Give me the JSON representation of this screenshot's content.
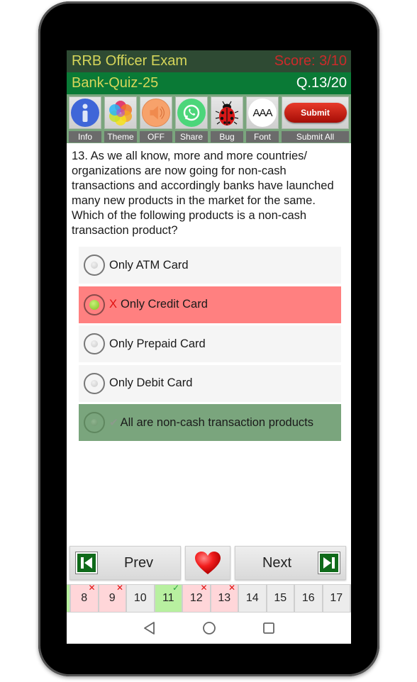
{
  "header": {
    "app_title": "RRB Officer Exam",
    "score": "Score: 3/10",
    "quiz_name": "Bank-Quiz-25",
    "question_counter": "Q.13/20"
  },
  "toolbar": {
    "items": [
      {
        "label": "Info",
        "icon": "info-icon"
      },
      {
        "label": "Theme",
        "icon": "theme-petals-icon"
      },
      {
        "label": "OFF",
        "icon": "speaker-icon"
      },
      {
        "label": "Share",
        "icon": "whatsapp-icon"
      },
      {
        "label": "Bug",
        "icon": "ladybug-icon"
      },
      {
        "label": "Font",
        "icon": "font-size-icon"
      },
      {
        "label": "Submit All",
        "icon": "submit-button"
      }
    ],
    "submit_button_text": "Submit",
    "font_icon_text": "AAA"
  },
  "question": {
    "paragraph1": "13. As we all know, more and more countries/ organizations are now going for non-cash transactions and accordingly banks have launched many new products in the market for the same.",
    "paragraph2": "Which of the following products is a non-cash transaction product?"
  },
  "options": [
    {
      "text": "Only ATM Card",
      "state": "normal",
      "mark": ""
    },
    {
      "text": "Only Credit Card",
      "state": "wrong",
      "mark": "X"
    },
    {
      "text": "Only Prepaid Card",
      "state": "normal",
      "mark": ""
    },
    {
      "text": "Only Debit Card",
      "state": "normal",
      "mark": ""
    },
    {
      "text": "All are non-cash transaction products",
      "state": "correct",
      "mark": "✔"
    }
  ],
  "nav": {
    "prev_label": "Prev",
    "next_label": "Next"
  },
  "question_strip": [
    {
      "num": "8",
      "status": "wrong",
      "badge": "✕"
    },
    {
      "num": "9",
      "status": "wrong",
      "badge": "✕"
    },
    {
      "num": "10",
      "status": "unanswered",
      "badge": ""
    },
    {
      "num": "11",
      "status": "right",
      "badge": "✓"
    },
    {
      "num": "12",
      "status": "wrong",
      "badge": "✕"
    },
    {
      "num": "13",
      "status": "wrong",
      "badge": "✕"
    },
    {
      "num": "14",
      "status": "unanswered",
      "badge": ""
    },
    {
      "num": "15",
      "status": "unanswered",
      "badge": ""
    },
    {
      "num": "16",
      "status": "unanswered",
      "badge": ""
    },
    {
      "num": "17",
      "status": "unanswered",
      "badge": ""
    }
  ],
  "colors": {
    "header_dark": "#2e4a33",
    "header_green": "#0a7a36",
    "title_yellow": "#d6d65a",
    "score_red": "#cc2a2a",
    "wrong_bg": "#ff8080",
    "correct_bg": "#7aa57d"
  }
}
